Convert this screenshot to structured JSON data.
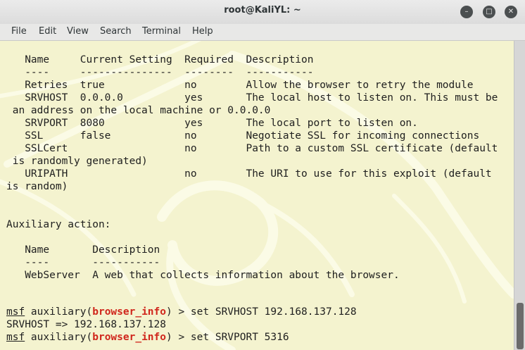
{
  "window": {
    "title": "root@KaliYL: ~",
    "minimize_glyph": "–",
    "maximize_glyph": "□",
    "close_glyph": "✕"
  },
  "menubar": {
    "items": [
      "File",
      "Edit",
      "View",
      "Search",
      "Terminal",
      "Help"
    ]
  },
  "terminal": {
    "lines": [
      "   Name     Current Setting  Required  Description",
      "   ----     ---------------  --------  -----------",
      "   Retries  true             no        Allow the browser to retry the module",
      "   SRVHOST  0.0.0.0          yes       The local host to listen on. This must be",
      " an address on the local machine or 0.0.0.0",
      "   SRVPORT  8080             yes       The local port to listen on.",
      "   SSL      false            no        Negotiate SSL for incoming connections",
      "   SSLCert                   no        Path to a custom SSL certificate (default",
      " is randomly generated)",
      "   URIPATH                   no        The URI to use for this exploit (default",
      "is random)",
      "",
      "",
      "Auxiliary action:",
      "",
      "   Name       Description",
      "   ----       -----------",
      "   WebServer  A web that collects information about the browser.",
      "",
      ""
    ],
    "prompt_msf": "msf",
    "prompt_prefix": " auxiliary(",
    "prompt_module": "browser_info",
    "prompt_suffix": ") > ",
    "cmd1": "set SRVHOST 192.168.137.128",
    "output1": "SRVHOST => 192.168.137.128",
    "cmd2": "set SRVPORT 5316",
    "background_color": "#f4f3cf",
    "prompt_module_color": "#d0261c"
  }
}
